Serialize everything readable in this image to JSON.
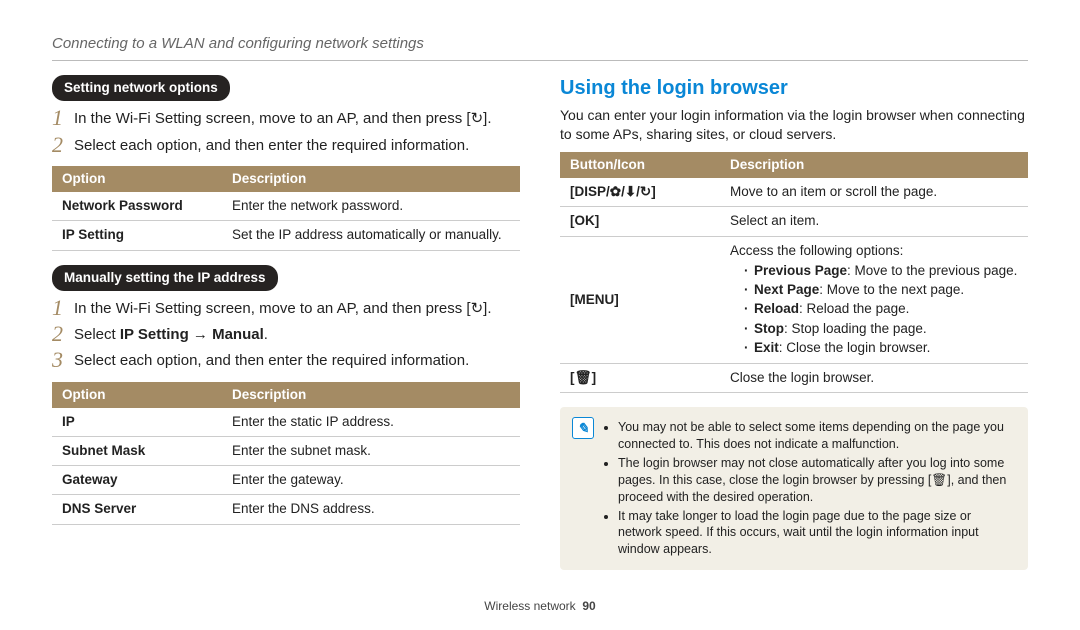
{
  "header_title": "Connecting to a WLAN and configuring network settings",
  "left": {
    "section1_pill": "Setting network options",
    "section1_steps": [
      "In the Wi-Fi Setting screen, move to an AP, and then press [↻].",
      "Select each option, and then enter the required information."
    ],
    "table1_head_option": "Option",
    "table1_head_desc": "Description",
    "table1_rows": [
      {
        "k": "Network Password",
        "v": "Enter the network password."
      },
      {
        "k": "IP Setting",
        "v": "Set the IP address automatically or manually."
      }
    ],
    "section2_pill": "Manually setting the IP address",
    "section2_steps": [
      {
        "text": "In the Wi-Fi Setting screen, move to an AP, and then press [↻]."
      },
      {
        "prefix": "Select ",
        "bold": "IP Setting → Manual",
        "suffix": "."
      },
      {
        "text": "Select each option, and then enter the required information."
      }
    ],
    "table2_head_option": "Option",
    "table2_head_desc": "Description",
    "table2_rows": [
      {
        "k": "IP",
        "v": "Enter the static IP address."
      },
      {
        "k": "Subnet Mask",
        "v": "Enter the subnet mask."
      },
      {
        "k": "Gateway",
        "v": "Enter the gateway."
      },
      {
        "k": "DNS Server",
        "v": "Enter the DNS address."
      }
    ]
  },
  "right": {
    "title": "Using the login browser",
    "lead": "You can enter your login information via the login browser when connecting to some APs, sharing sites, or cloud servers.",
    "table_head_button": "Button/Icon",
    "table_head_desc": "Description",
    "rows": {
      "r1_key": "DISP/✿/⬇/↻",
      "r1_val": "Move to an item or scroll the page.",
      "r2_key": "OK",
      "r2_val": "Select an item.",
      "r3_key": "MENU",
      "r3_intro": "Access the following options:",
      "r3_items": [
        {
          "b": "Previous Page",
          "t": ": Move to the previous page."
        },
        {
          "b": "Next Page",
          "t": ": Move to the next page."
        },
        {
          "b": "Reload",
          "t": ": Reload the page."
        },
        {
          "b": "Stop",
          "t": ": Stop loading the page."
        },
        {
          "b": "Exit",
          "t": ": Close the login browser."
        }
      ],
      "r4_key": "🗑",
      "r4_val": "Close the login browser."
    },
    "notes": [
      "You may not be able to select some items depending on the page you connected to. This does not indicate a malfunction.",
      "The login browser may not close automatically after you log into some pages. In this case, close the login browser by pressing [🗑], and then proceed with the desired operation.",
      "It may take longer to load the login page due to the page size or network speed. If this occurs, wait until the login information input window appears."
    ]
  },
  "footer_section": "Wireless network",
  "footer_page": "90"
}
